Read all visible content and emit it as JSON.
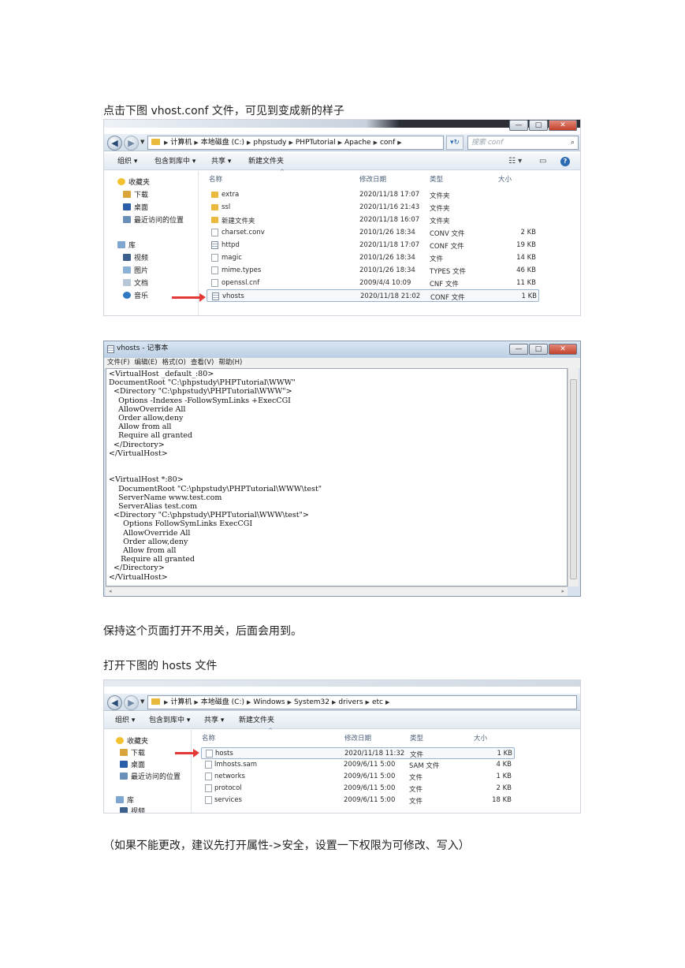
{
  "paragraphs": {
    "p1": "点击下图 vhost.conf 文件，可见到变成新的样子",
    "p2": "保持这个页面打开不用关，后面会用到。",
    "p3": "打开下图的 hosts 文件",
    "p4": "（如果不能更改，建议先打开属性->安全，设置一下权限为可修改、写入）"
  },
  "explorer1": {
    "breadcrumb": [
      "计算机",
      "本地磁盘 (C:)",
      "phpstudy",
      "PHPTutorial",
      "Apache",
      "conf"
    ],
    "search_placeholder": "搜索 conf",
    "toolbar": {
      "organize": "组织 ▾",
      "include": "包含到库中 ▾",
      "share": "共享 ▾",
      "new_folder": "新建文件夹"
    },
    "nav": {
      "favorites": "收藏夹",
      "downloads": "下载",
      "desktop": "桌面",
      "recent": "最近访问的位置",
      "libraries": "库",
      "videos": "视频",
      "pictures": "图片",
      "documents": "文档",
      "music": "音乐"
    },
    "columns": {
      "name": "名称",
      "date": "修改日期",
      "type": "类型",
      "size": "大小"
    },
    "files": [
      {
        "name": "extra",
        "date": "2020/11/18 17:07",
        "type": "文件夹",
        "size": "",
        "icon": "folder"
      },
      {
        "name": "ssl",
        "date": "2020/11/16 21:43",
        "type": "文件夹",
        "size": "",
        "icon": "folder"
      },
      {
        "name": "新建文件夹",
        "date": "2020/11/18 16:07",
        "type": "文件夹",
        "size": "",
        "icon": "folder"
      },
      {
        "name": "charset.conv",
        "date": "2010/1/26 18:34",
        "type": "CONV 文件",
        "size": "2 KB",
        "icon": "doc"
      },
      {
        "name": "httpd",
        "date": "2020/11/18 17:07",
        "type": "CONF 文件",
        "size": "19 KB",
        "icon": "conf"
      },
      {
        "name": "magic",
        "date": "2010/1/26 18:34",
        "type": "文件",
        "size": "14 KB",
        "icon": "doc"
      },
      {
        "name": "mime.types",
        "date": "2010/1/26 18:34",
        "type": "TYPES 文件",
        "size": "46 KB",
        "icon": "doc"
      },
      {
        "name": "openssl.cnf",
        "date": "2009/4/4 10:09",
        "type": "CNF 文件",
        "size": "11 KB",
        "icon": "doc"
      },
      {
        "name": "vhosts",
        "date": "2020/11/18 21:02",
        "type": "CONF 文件",
        "size": "1 KB",
        "icon": "conf"
      }
    ]
  },
  "notepad": {
    "title": "vhosts - 记事本",
    "menu": [
      "文件(F)",
      "编辑(E)",
      "格式(O)",
      "查看(V)",
      "帮助(H)"
    ],
    "lines": [
      "<VirtualHost _default_:80>",
      "DocumentRoot \"C:\\phpstudy\\PHPTutorial\\WWW\"",
      "  <Directory \"C:\\phpstudy\\PHPTutorial\\WWW\">",
      "    Options -Indexes -FollowSymLinks +ExecCGI",
      "    AllowOverride All",
      "    Order allow,deny",
      "    Allow from all",
      "    Require all granted",
      "  </Directory>",
      "</VirtualHost>",
      "",
      "",
      "<VirtualHost *:80>",
      "    DocumentRoot \"C:\\phpstudy\\PHPTutorial\\WWW\\test\"",
      "    ServerName www.test.com",
      "    ServerAlias test.com",
      "  <Directory \"C:\\phpstudy\\PHPTutorial\\WWW\\test\">",
      "      Options FollowSymLinks ExecCGI",
      "      AllowOverride All",
      "      Order allow,deny",
      "      Allow from all",
      "     Require all granted",
      "  </Directory>",
      "</VirtualHost>"
    ]
  },
  "explorer2": {
    "breadcrumb": [
      "计算机",
      "本地磁盘 (C:)",
      "Windows",
      "System32",
      "drivers",
      "etc"
    ],
    "toolbar": {
      "organize": "组织 ▾",
      "include": "包含到库中 ▾",
      "share": "共享 ▾",
      "new_folder": "新建文件夹"
    },
    "nav": {
      "favorites": "收藏夹",
      "downloads": "下载",
      "desktop": "桌面",
      "recent": "最近访问的位置",
      "libraries": "库",
      "videos": "视频"
    },
    "columns": {
      "name": "名称",
      "date": "修改日期",
      "type": "类型",
      "size": "大小"
    },
    "files": [
      {
        "name": "hosts",
        "date": "2020/11/18 11:32",
        "type": "文件",
        "size": "1 KB"
      },
      {
        "name": "lmhosts.sam",
        "date": "2009/6/11 5:00",
        "type": "SAM 文件",
        "size": "4 KB"
      },
      {
        "name": "networks",
        "date": "2009/6/11 5:00",
        "type": "文件",
        "size": "1 KB"
      },
      {
        "name": "protocol",
        "date": "2009/6/11 5:00",
        "type": "文件",
        "size": "2 KB"
      },
      {
        "name": "services",
        "date": "2009/6/11 5:00",
        "type": "文件",
        "size": "18 KB"
      }
    ]
  }
}
